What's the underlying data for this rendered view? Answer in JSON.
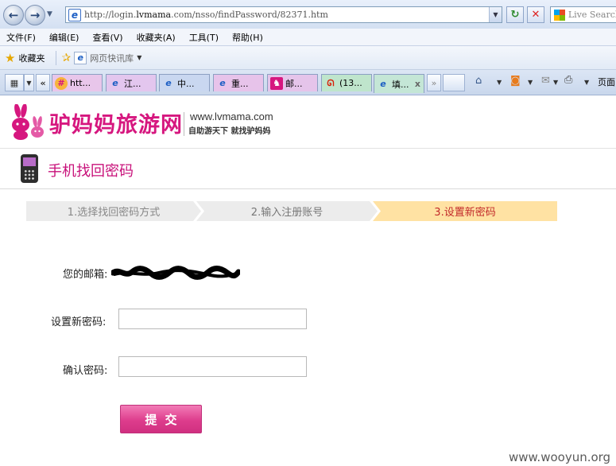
{
  "browser": {
    "address_prefix": "http://login.",
    "address_domain": "lvmama",
    "address_suffix": ".com/nsso/findPassword/82371.htm",
    "search_placeholder": "Live Search",
    "menu": [
      "文件(F)",
      "编辑(E)",
      "查看(V)",
      "收藏夹(A)",
      "工具(T)",
      "帮助(H)"
    ],
    "favorites_label": "收藏夹",
    "quick_link": "网页快讯库",
    "tabs": [
      {
        "label": "htt...",
        "icon": "grid-site-icon",
        "bg": "#e8c6ea",
        "icon_color": "#d6177f"
      },
      {
        "label": "江...",
        "icon": "ie-icon",
        "bg": "#e3c6ee",
        "icon_color": "#1d5fc4"
      },
      {
        "label": "中...",
        "icon": "ie-icon",
        "bg": "#c9d7f0",
        "icon_color": "#1d5fc4"
      },
      {
        "label": "重...",
        "icon": "ie-icon",
        "bg": "#e7c3ea",
        "icon_color": "#1d5fc4"
      },
      {
        "label": "邮...",
        "icon": "bunny-icon",
        "bg": "#e5c4ea",
        "icon_color": "#d6177f"
      },
      {
        "label": "(13...",
        "icon": "weibo-icon",
        "bg": "#bfe5cc",
        "icon_color": "#d81e06"
      },
      {
        "label": "填...",
        "icon": "ie-icon",
        "bg": "#c4e6d6",
        "icon_color": "#1d5fc4"
      }
    ],
    "tab_close": "x",
    "tab_scroll_left": "«",
    "tab_scroll_right": "»",
    "page_menu": "页面"
  },
  "site": {
    "logo_cn": "驴妈妈旅游网",
    "logo_url": "www.lvmama.com",
    "slogan": "自助游天下 就找驴妈妈",
    "page_title": "手机找回密码",
    "brand_color": "#d6177f"
  },
  "steps": [
    {
      "label": "1.选择找回密码方式",
      "state": "done"
    },
    {
      "label": "2.输入注册账号",
      "state": "done"
    },
    {
      "label": "3.设置新密码",
      "state": "current"
    }
  ],
  "form": {
    "email_label": "您的邮箱:",
    "new_password_label": "设置新密码:",
    "new_password_value": "",
    "confirm_label": "确认密码:",
    "confirm_value": "",
    "submit_label": "提交"
  },
  "watermark": "www.wooyun.org"
}
